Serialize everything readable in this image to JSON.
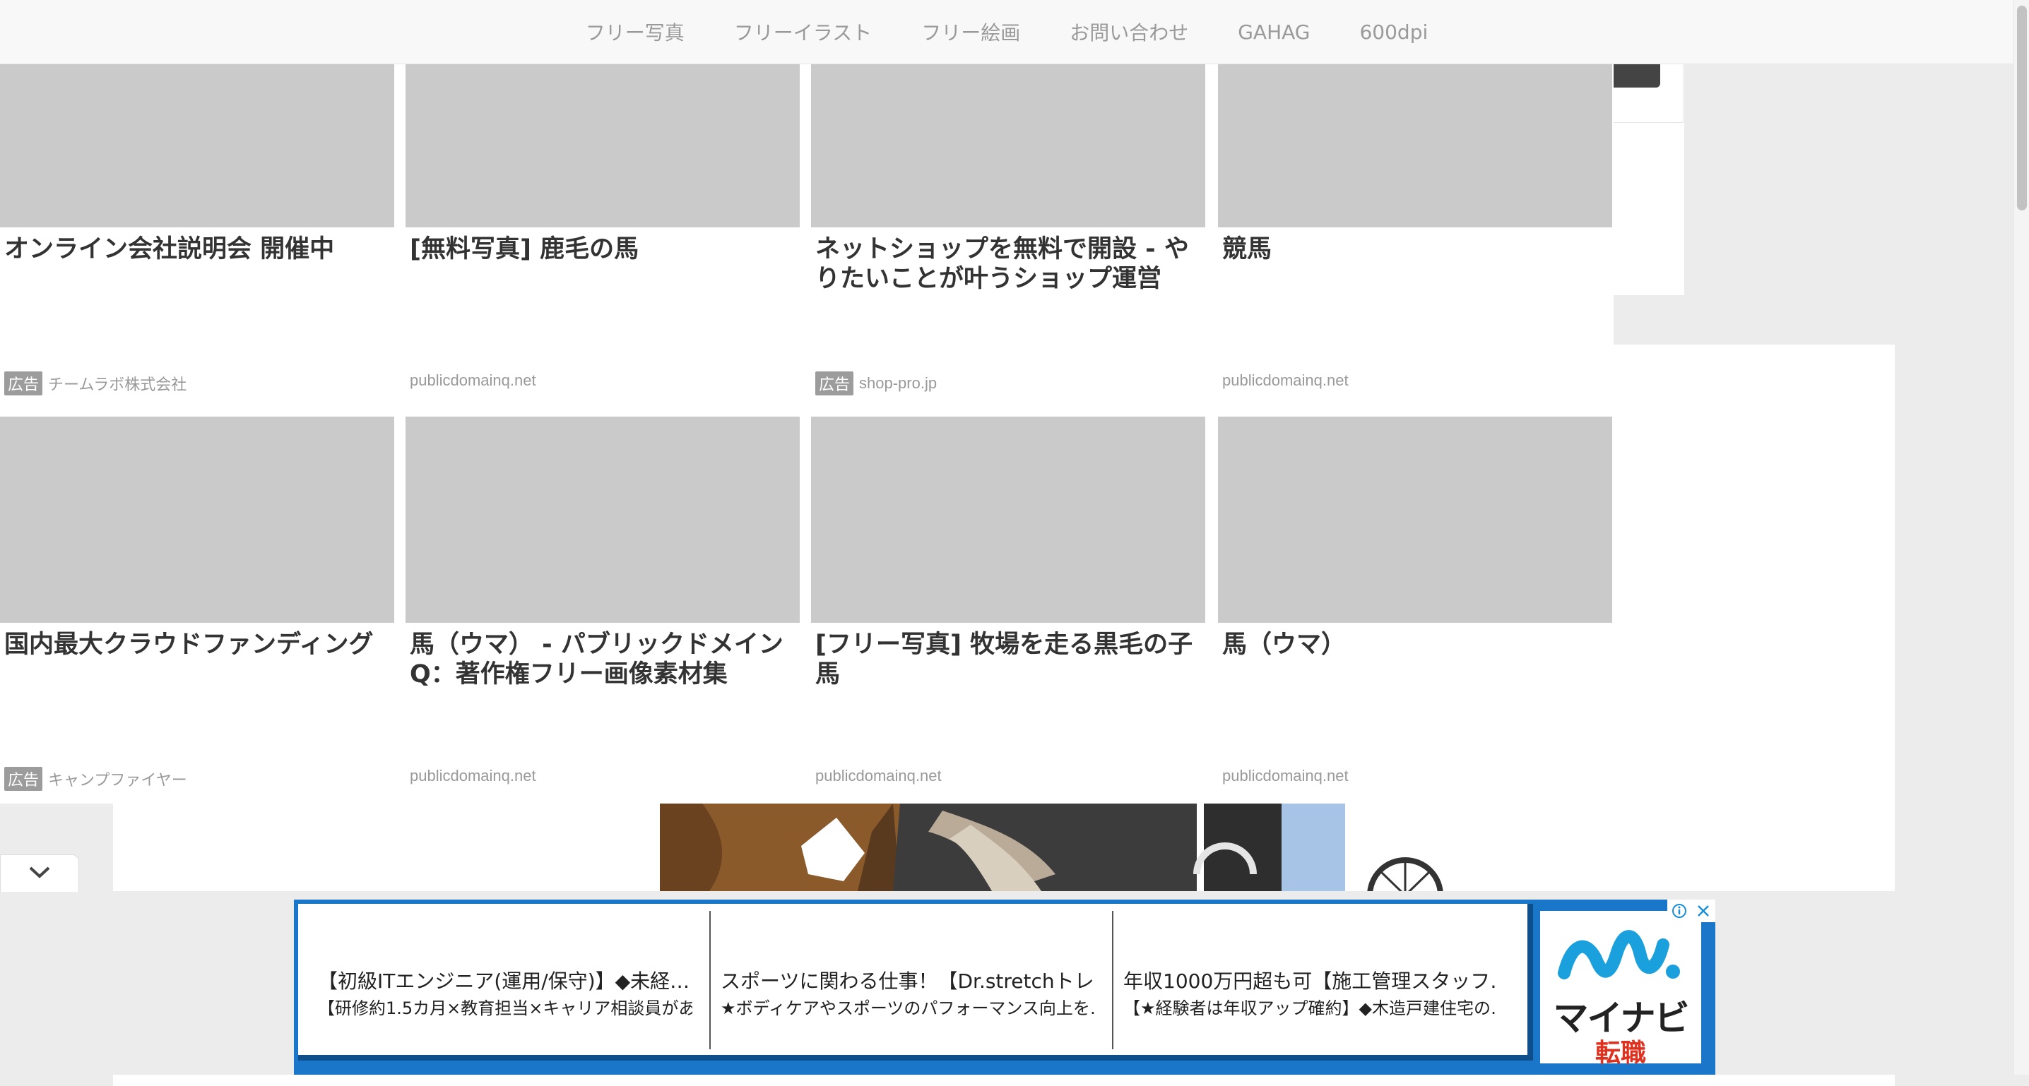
{
  "nav": {
    "items": [
      "フリー写真",
      "フリーイラスト",
      "フリー絵画",
      "お問い合わせ",
      "GAHAG",
      "600dpi"
    ]
  },
  "cards": [
    {
      "title": "オンライン会社説明会 開催中",
      "ad_label": "広告",
      "source": "チームラボ株式会社"
    },
    {
      "title": "[無料写真] 鹿毛の馬",
      "ad_label": "",
      "source": "publicdomainq.net"
    },
    {
      "title": "ネットショップを無料で開設 - やりたいことが叶うショップ運営",
      "ad_label": "広告",
      "source": "shop-pro.jp"
    },
    {
      "title": "競馬",
      "ad_label": "",
      "source": "publicdomainq.net"
    },
    {
      "title": "国内最大クラウドファンディング",
      "ad_label": "広告",
      "source": "キャンプファイヤー"
    },
    {
      "title": "馬（ウマ） - パブリックドメインQ：著作権フリー画像素材集",
      "ad_label": "",
      "source": "publicdomainq.net"
    },
    {
      "title": "[フリー写真] 牧場を走る黒毛の子馬",
      "ad_label": "",
      "source": "publicdomainq.net"
    },
    {
      "title": "馬（ウマ）",
      "ad_label": "",
      "source": "publicdomainq.net"
    }
  ],
  "bottom_ad": {
    "listings": [
      {
        "title": "【初級ITエンジニア(運用/保守)】◆未経…",
        "desc": "【研修約1.5カ月×教育担当×キャリア相談員があ…"
      },
      {
        "title": "スポーツに関わる仕事！【Dr.stretchトレ…",
        "desc": "★ボディケアやスポーツのパフォーマンス向上を…"
      },
      {
        "title": "年収1000万円超も可【施工管理スタッフ…",
        "desc": "【★経験者は年収アップ確約】◆木造戸建住宅の…"
      }
    ],
    "logo_text": "マイナビ",
    "logo_sub": "転職",
    "info_icon": "info-icon",
    "close_icon": "close-icon"
  },
  "colors": {
    "ad_frame": "#1976c9",
    "logo_red": "#e0301e",
    "thumb_placeholder": "#cacaca"
  }
}
